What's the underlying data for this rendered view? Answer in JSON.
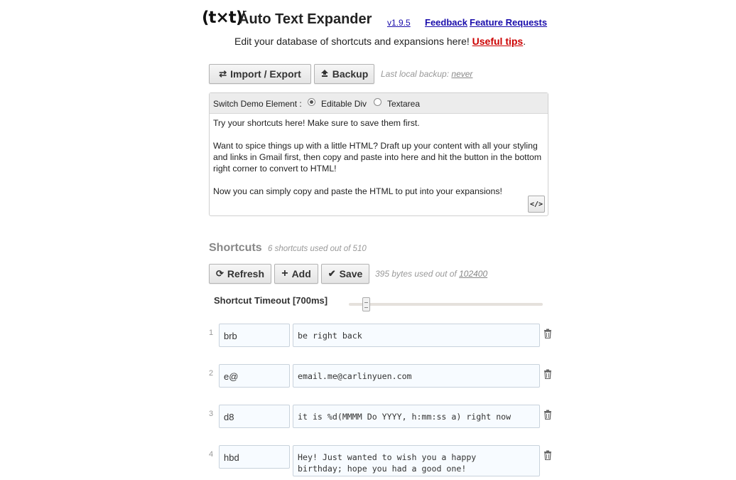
{
  "header": {
    "logo_text": "(t×t)",
    "logo_sup": "r",
    "title": "Auto Text Expander",
    "version": "v1.9.5",
    "feedback": "Feedback",
    "feature_requests": "Feature Requests",
    "subtitle": "Edit your database of shortcuts and expansions here!",
    "tips": "Useful tips",
    "tips_suffix": "."
  },
  "toolbar": {
    "import_export": "Import / Export",
    "backup": "Backup",
    "last_backup_label": "Last local backup:",
    "last_backup_value": "never"
  },
  "demo": {
    "switch_label": "Switch Demo Element :",
    "option_div": "Editable Div",
    "option_textarea": "Textarea",
    "selected": "Editable Div",
    "paragraphs": [
      "Try your shortcuts here! Make sure to save them first.",
      "Want to spice things up with a little HTML? Draft up your content with all your styling and links in Gmail first, then copy and paste into here and hit the button in the bottom right corner to convert to HTML!",
      "Now you can simply copy and paste the HTML to put into your expansions!"
    ],
    "convert_button": "</>"
  },
  "shortcuts": {
    "heading": "Shortcuts",
    "count_text": "6 shortcuts used out of 510",
    "refresh": "Refresh",
    "add": "Add",
    "save": "Save",
    "bytes_text": "395 bytes used out of",
    "bytes_limit": "102400",
    "timeout_label": "Shortcut Timeout [700ms]",
    "timeout_ms": 700,
    "rows": [
      {
        "num": "1",
        "shortcut": "brb",
        "expansion": "be right back"
      },
      {
        "num": "2",
        "shortcut": "e@",
        "expansion": "email.me@carlinyuen.com"
      },
      {
        "num": "3",
        "shortcut": "d8",
        "expansion": "it is %d(MMMM Do YYYY, h:mm:ss a) right now"
      },
      {
        "num": "4",
        "shortcut": "hbd",
        "expansion": "Hey! Just wanted to wish you a happy\nbirthday; hope you had a good one!"
      }
    ]
  },
  "icons": {
    "import_export": "swap-arrows-icon",
    "backup": "upload-icon",
    "refresh": "refresh-icon",
    "add": "plus-icon",
    "save": "checkmark-icon",
    "delete": "trash-icon"
  },
  "colors": {
    "link": "#1a0dab",
    "tips_link": "#cc0000",
    "input_bg": "#f7fbff"
  }
}
